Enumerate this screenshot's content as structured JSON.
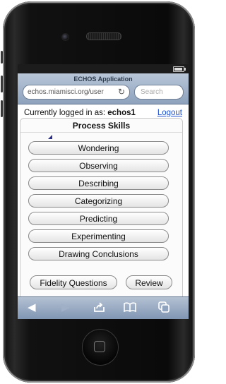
{
  "browser": {
    "page_title": "ECHOS Application",
    "url": "echos.miamisci.org/user",
    "search_placeholder": "Search"
  },
  "header": {
    "logged_in_label": "Currently logged in as:",
    "username": "echos1",
    "logout_label": "Logout"
  },
  "panel": {
    "title": "Process Skills",
    "skills": [
      "Wondering",
      "Observing",
      "Describing",
      "Categorizing",
      "Predicting",
      "Experimenting",
      "Drawing Conclusions"
    ],
    "fidelity_label": "Fidelity Questions",
    "review_label": "Review"
  },
  "toolbar": {
    "icons": [
      "back-icon",
      "forward-icon",
      "share-icon",
      "bookmarks-icon",
      "pages-icon"
    ]
  }
}
